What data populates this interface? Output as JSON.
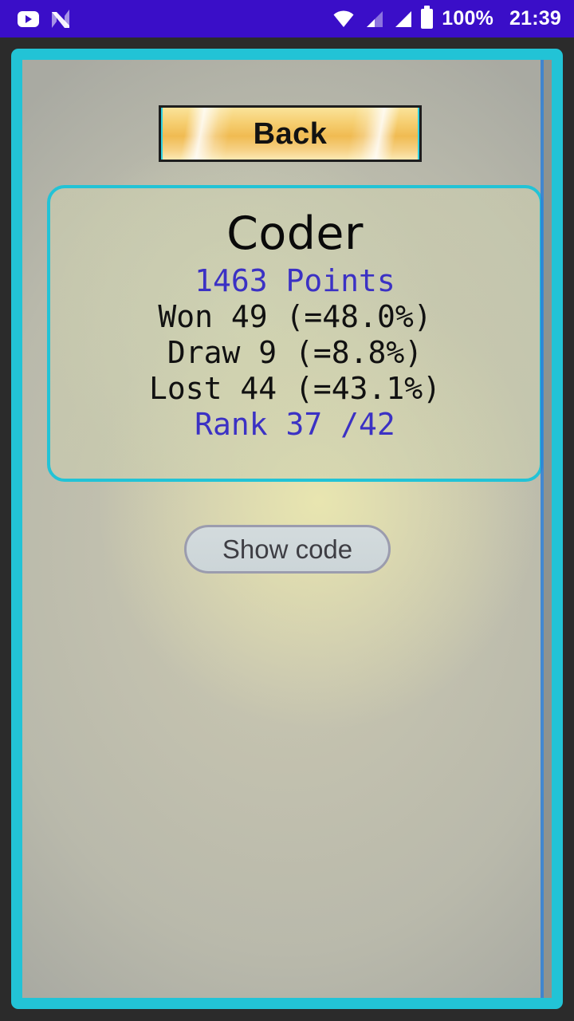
{
  "statusbar": {
    "notifications": [
      {
        "icon": "youtube-icon",
        "name": "youtube"
      },
      {
        "icon": "nova-launcher-icon",
        "name": "nova"
      }
    ],
    "system": [
      {
        "icon": "wifi-icon"
      },
      {
        "icon": "signal-bars-icon-sim1"
      },
      {
        "icon": "signal-bars-icon-sim2"
      },
      {
        "icon": "battery-icon"
      }
    ],
    "battery_text": "100%",
    "clock": "21:39",
    "background_color": "#3a0ec8",
    "foreground_color": "#ffffff"
  },
  "frame": {
    "accent_color": "#22c3d6",
    "outer_color": "#2b2b2b"
  },
  "toolbar": {
    "back_label": "Back"
  },
  "stats_card": {
    "player_name": "Coder",
    "points_line": "1463 Points",
    "won_line": "Won 49 (=48.0%)",
    "draw_line": "Draw 9 (=8.8%)",
    "lost_line": "Lost 44 (=43.1%)",
    "rank_line": "Rank 37 /42",
    "accent_color": "#22c3d6",
    "highlight_text_color": "#3b31c4",
    "body_text_color": "#111111"
  },
  "actions": {
    "show_code_label": "Show code"
  }
}
